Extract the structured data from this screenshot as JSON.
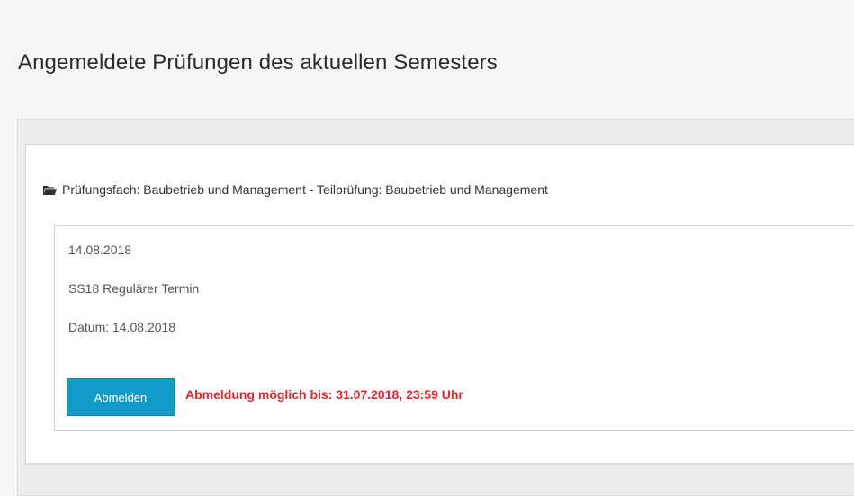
{
  "page": {
    "title": "Angemeldete Prüfungen des aktuellen Semesters"
  },
  "exam": {
    "icon": "folder-open-icon",
    "subject": "Prüfungsfach: Baubetrieb und Management - Teilprüfung: Baubetrieb und Management",
    "date": "14.08.2018",
    "term": "SS18 Regulärer Termin",
    "datum": "Datum: 14.08.2018",
    "deregister_label": "Abmelden",
    "deadline_text": "Abmeldung möglich bis: 31.07.2018, 23:59 Uhr"
  },
  "colors": {
    "button": "#139bc8",
    "deadline": "#e0262b",
    "background": "#f6f6f6"
  }
}
